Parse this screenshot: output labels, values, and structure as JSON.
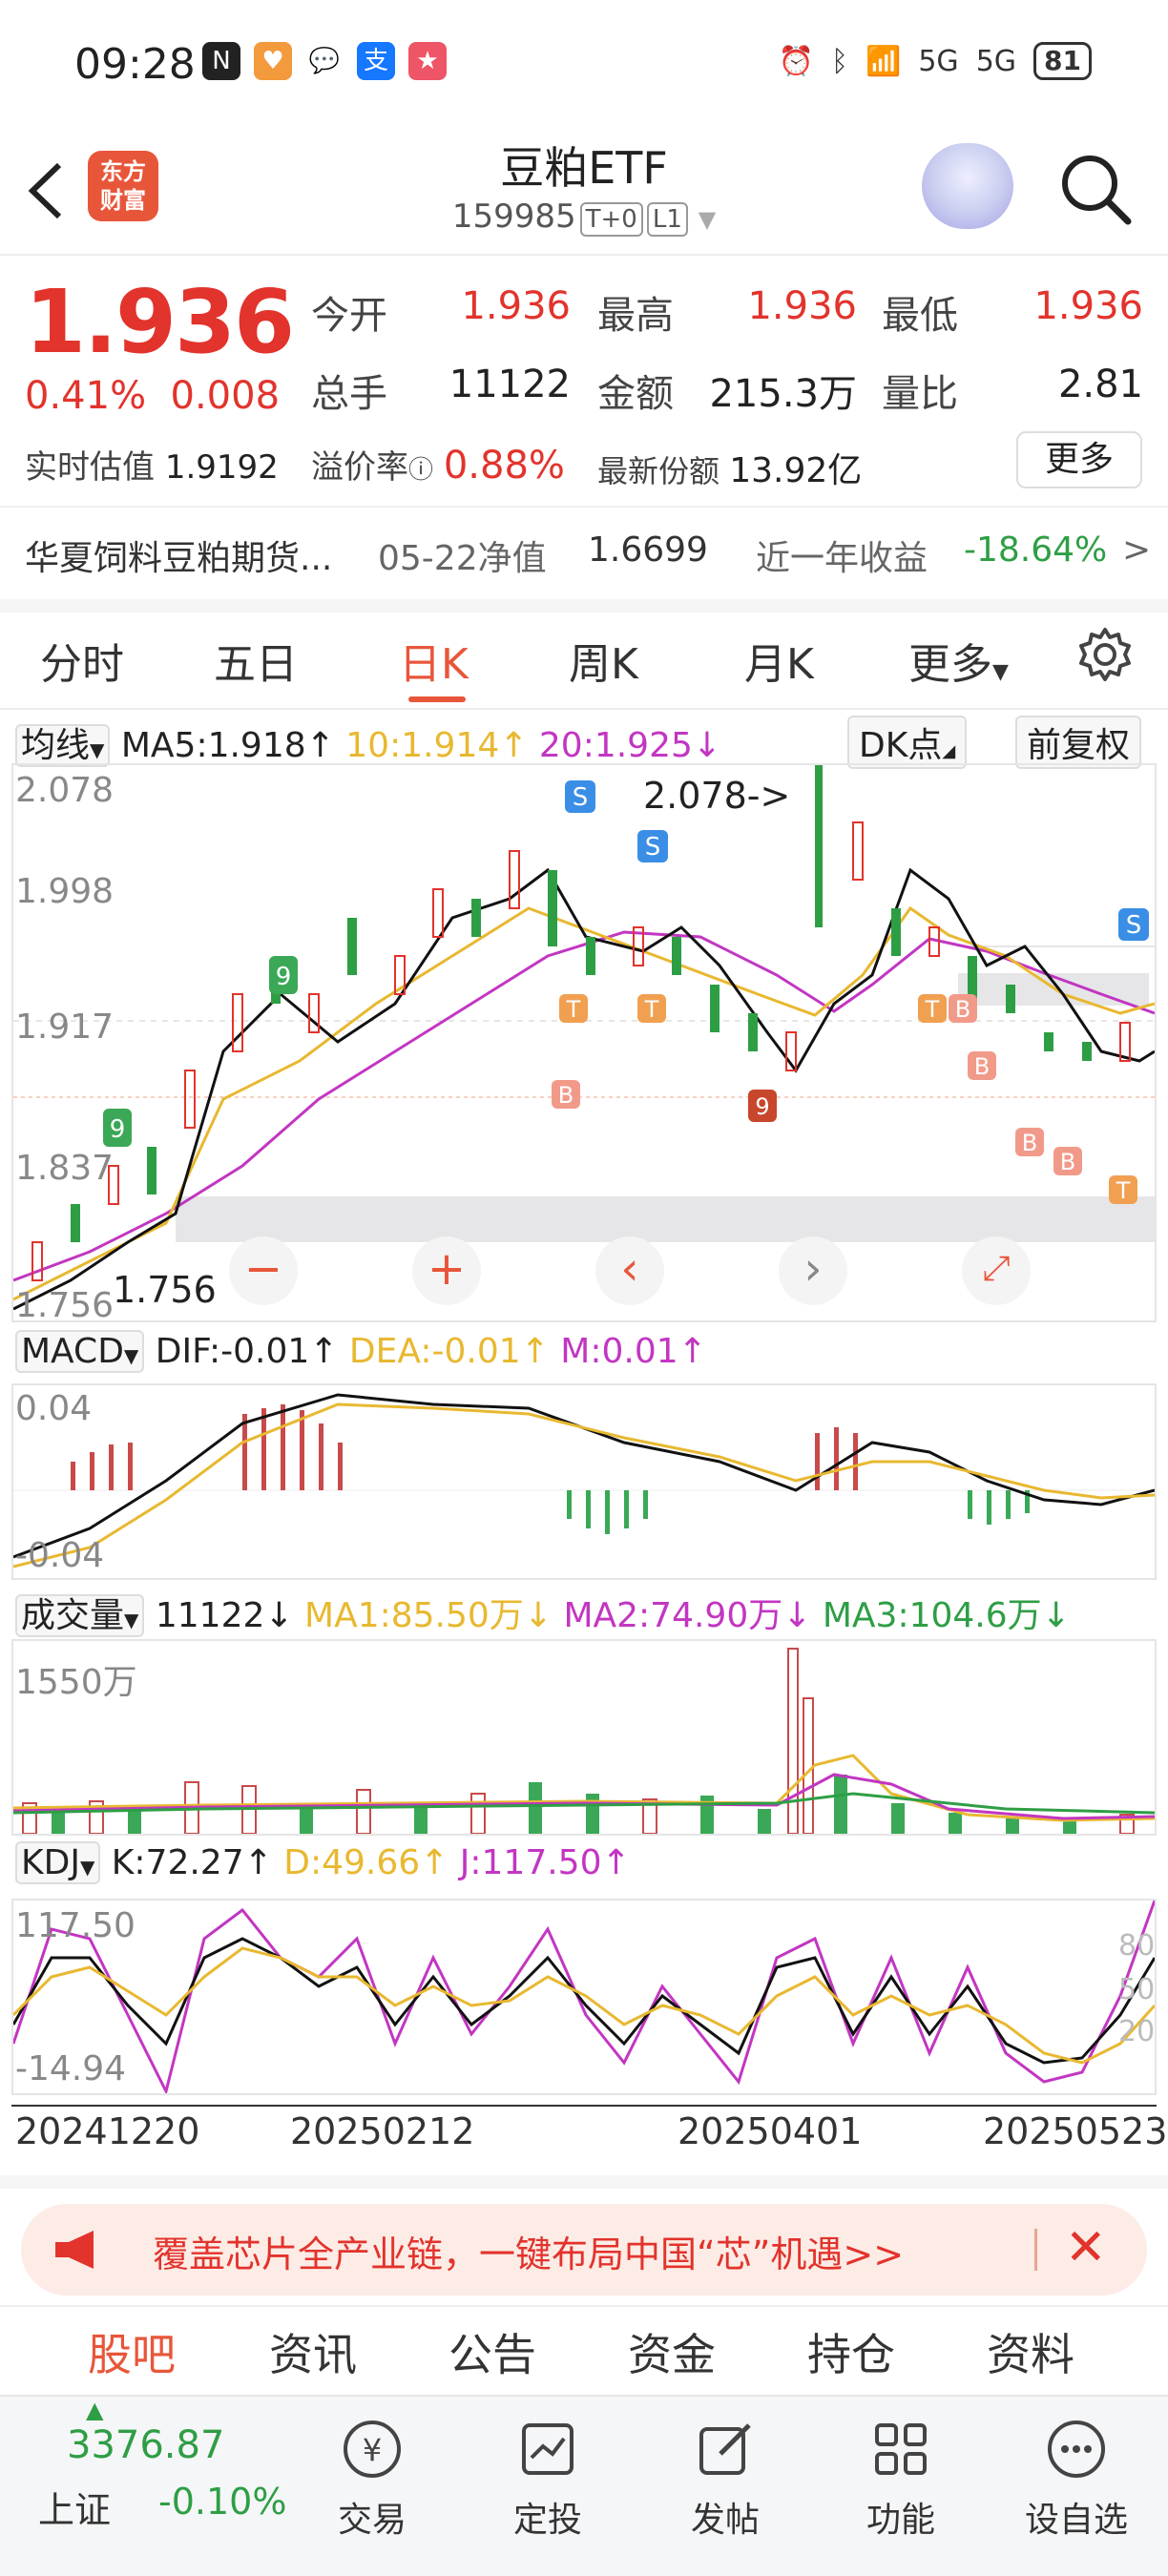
{
  "status": {
    "time": "09:28",
    "battery": "81",
    "network": "5G"
  },
  "header": {
    "logo_line1": "东方",
    "logo_line2": "财富",
    "title": "豆粕ETF",
    "code": "159985",
    "tag1": "T+0",
    "tag2": "L1"
  },
  "quote": {
    "price": "1.936",
    "change_pct": "0.41%",
    "change_abs": "0.008",
    "open_label": "今开",
    "open": "1.936",
    "high_label": "最高",
    "high": "1.936",
    "low_label": "最低",
    "low": "1.936",
    "volume_label": "总手",
    "volume": "11122",
    "amount_label": "金额",
    "amount": "215.3万",
    "ratio_label": "量比",
    "ratio": "2.81",
    "est_label": "实时估值",
    "est": "1.9192",
    "premium_label": "溢价率",
    "premium": "0.88%",
    "share_label": "最新份额",
    "share": "13.92亿",
    "more_label": "更多"
  },
  "fund": {
    "name": "华夏饲料豆粕期货...",
    "nav_label": "05-22净值",
    "nav": "1.6699",
    "yr_label": "近一年收益",
    "yr": "-18.64%"
  },
  "tabs": [
    "分时",
    "五日",
    "日K",
    "周K",
    "月K",
    "更多"
  ],
  "active_tab": "日K",
  "kline": {
    "indicator": "均线",
    "ma5": "MA5:1.918",
    "ma10": "10:1.914",
    "ma20": "20:1.925",
    "dk_label": "DK点",
    "adjust_label": "前复权",
    "y_labels": [
      "2.078",
      "1.998",
      "1.917",
      "1.837",
      "1.756"
    ],
    "high_note": "2.078->",
    "low_note": "1.756"
  },
  "macd": {
    "label": "MACD",
    "dif": "DIF:-0.01",
    "dea": "DEA:-0.01",
    "m": "M:0.01",
    "y_top": "0.04",
    "y_bottom": "-0.04"
  },
  "volume": {
    "label": "成交量",
    "v": "11122",
    "ma1": "MA1:85.50万",
    "ma2": "MA2:74.90万",
    "ma3": "MA3:104.6万",
    "y_top": "1550万"
  },
  "kdj": {
    "label": "KDJ",
    "k": "K:72.27",
    "d": "D:49.66",
    "j": "J:117.50",
    "y_top": "117.50",
    "y_bottom": "-14.94",
    "r80": "80",
    "r50": "50",
    "r20": "20"
  },
  "dates": [
    "20241220",
    "20250212",
    "20250401",
    "20250523"
  ],
  "ad": {
    "text": "覆盖芯片全产业链，一键布局中国“芯”机遇>>"
  },
  "bottom_tabs": [
    "股吧",
    "资讯",
    "公告",
    "资金",
    "持仓",
    "资料"
  ],
  "footer": {
    "index_value": "3376.87",
    "index_name": "上证",
    "index_change": "-0.10%",
    "items": [
      "交易",
      "定投",
      "发帖",
      "功能",
      "设自选"
    ]
  }
}
